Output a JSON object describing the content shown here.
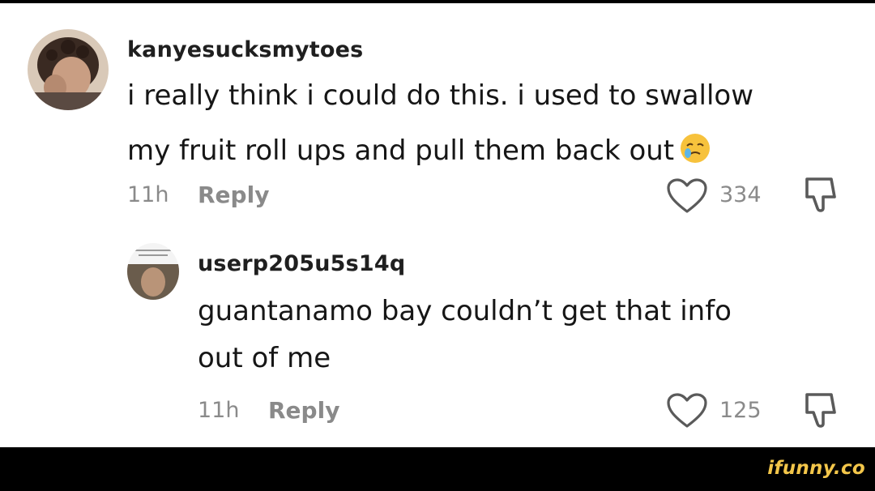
{
  "comments": [
    {
      "username": "kanyesucksmytoes",
      "lines": [
        "i really think i could do this. i used to swallow",
        "my fruit roll ups and pull them back out"
      ],
      "emoji": "crying-face-emoji",
      "time": "11h",
      "reply_label": "Reply",
      "likes": "334"
    },
    {
      "username": "userp205u5s14q",
      "lines": [
        "guantanamo bay couldn’t get that info",
        "out of me"
      ],
      "time": "11h",
      "reply_label": "Reply",
      "likes": "125"
    }
  ],
  "watermark": "ifunny.co",
  "colors": {
    "text": "#161616",
    "muted": "#8a8a8a",
    "watermark": "#f3c64a",
    "background": "#ffffff"
  }
}
